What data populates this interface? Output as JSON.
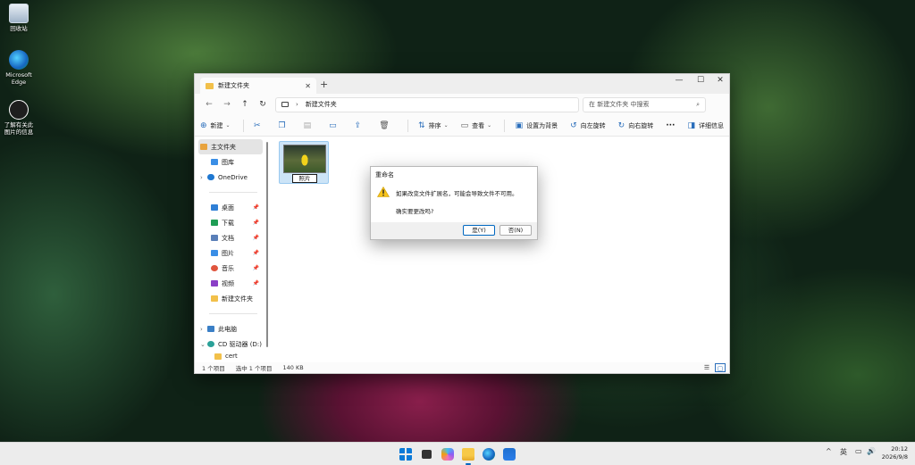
{
  "desktop": {
    "icons": [
      {
        "label": "回收站",
        "icon": "recycle-bin-icon"
      },
      {
        "label": "Microsoft Edge",
        "icon": "edge-icon"
      },
      {
        "label": "了解有关此图片的信息",
        "icon": "learn-about-picture-icon"
      }
    ]
  },
  "explorer": {
    "tab_title": "新建文件夹",
    "tab_close": "✕",
    "new_tab": "+",
    "window_controls": {
      "minimize": "—",
      "maximize": "☐",
      "close": "✕"
    },
    "nav": {
      "back": "←",
      "forward": "→",
      "up": "↑",
      "refresh": "↻"
    },
    "address": {
      "separator": "›",
      "path": "新建文件夹"
    },
    "search": {
      "placeholder": "在 新建文件夹 中搜索",
      "icon": "⌕"
    },
    "toolbar": {
      "new_label": "新建",
      "sort_label": "排序",
      "view_label": "查看",
      "set_background_label": "设置为背景",
      "rotate_left_label": "向左旋转",
      "rotate_right_label": "向右旋转",
      "more": "···",
      "details_label": "详细信息"
    },
    "sidebar": {
      "home": "主文件夹",
      "gallery": "图库",
      "onedrive": "OneDrive",
      "quick": [
        {
          "label": "桌面",
          "color": "#2f7fd6"
        },
        {
          "label": "下载",
          "color": "#1f9d55"
        },
        {
          "label": "文档",
          "color": "#5a7fb8"
        },
        {
          "label": "图片",
          "color": "#3a8ee6"
        },
        {
          "label": "音乐",
          "color": "#e0553e"
        },
        {
          "label": "视频",
          "color": "#8a3fc6"
        }
      ],
      "new_folder": "新建文件夹",
      "this_pc": "此电脑",
      "cd_drive": "CD 驱动器 (D:)",
      "cert": "cert"
    },
    "file": {
      "name": "照片"
    },
    "status": {
      "count": "1 个项目",
      "selected": "选中 1 个项目",
      "size": "140 KB"
    }
  },
  "dialog": {
    "title": "重命名",
    "message": "如果改变文件扩展名，可能会导致文件不可用。",
    "question": "确实要更改吗?",
    "yes": "是(Y)",
    "no": "否(N)"
  },
  "taskbar": {
    "lang": "英",
    "time": "20:12",
    "date": "2026/9/8",
    "chevron": "^"
  }
}
